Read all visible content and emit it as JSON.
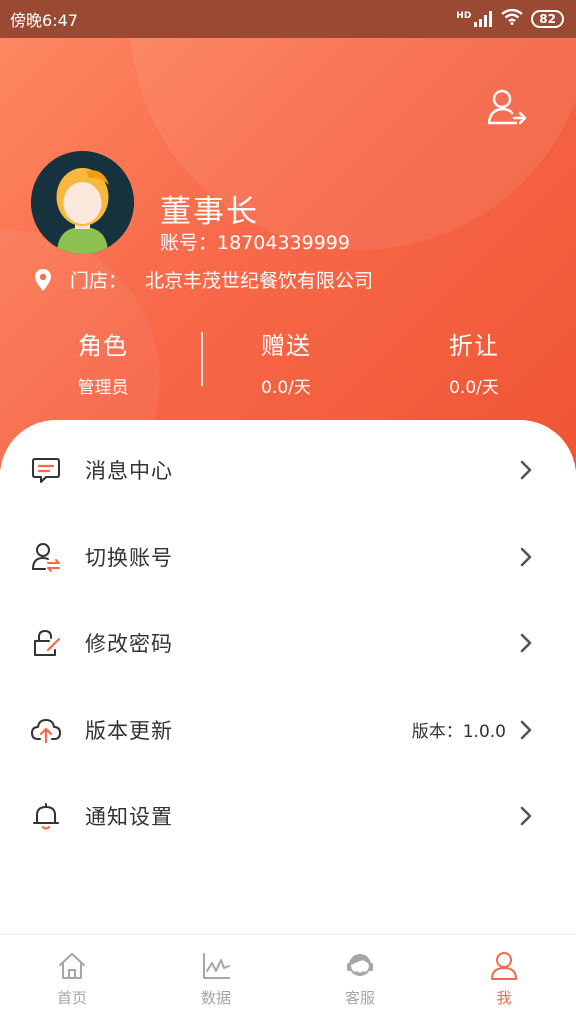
{
  "status_bar": {
    "time": "傍晚6:47",
    "network": "HD",
    "battery": "82"
  },
  "profile": {
    "name": "董事长",
    "account_label": "账号：",
    "account": "18704339999",
    "store_label": "门店：",
    "store_name": "北京丰茂世纪餐饮有限公司"
  },
  "stats": [
    {
      "title": "角色",
      "value": "管理员"
    },
    {
      "title": "赠送",
      "value": "0.0/天"
    },
    {
      "title": "折让",
      "value": "0.0/天"
    }
  ],
  "menu": [
    {
      "label": "消息中心",
      "icon": "message-icon"
    },
    {
      "label": "切换账号",
      "icon": "switch-account-icon"
    },
    {
      "label": "修改密码",
      "icon": "edit-password-icon"
    },
    {
      "label": "版本更新",
      "icon": "cloud-upload-icon",
      "extra": "版本：1.0.0"
    },
    {
      "label": "通知设置",
      "icon": "bell-icon"
    }
  ],
  "bottom_nav": [
    {
      "label": "首页",
      "icon": "home-icon"
    },
    {
      "label": "数据",
      "icon": "chart-icon"
    },
    {
      "label": "客服",
      "icon": "service-icon"
    },
    {
      "label": "我",
      "icon": "user-icon",
      "active": true
    }
  ],
  "colors": {
    "accent": "#f26a49",
    "gradient_start": "#fd8a62",
    "gradient_end": "#ef5533",
    "text": "#333333",
    "inactive": "#a6a6a6"
  }
}
